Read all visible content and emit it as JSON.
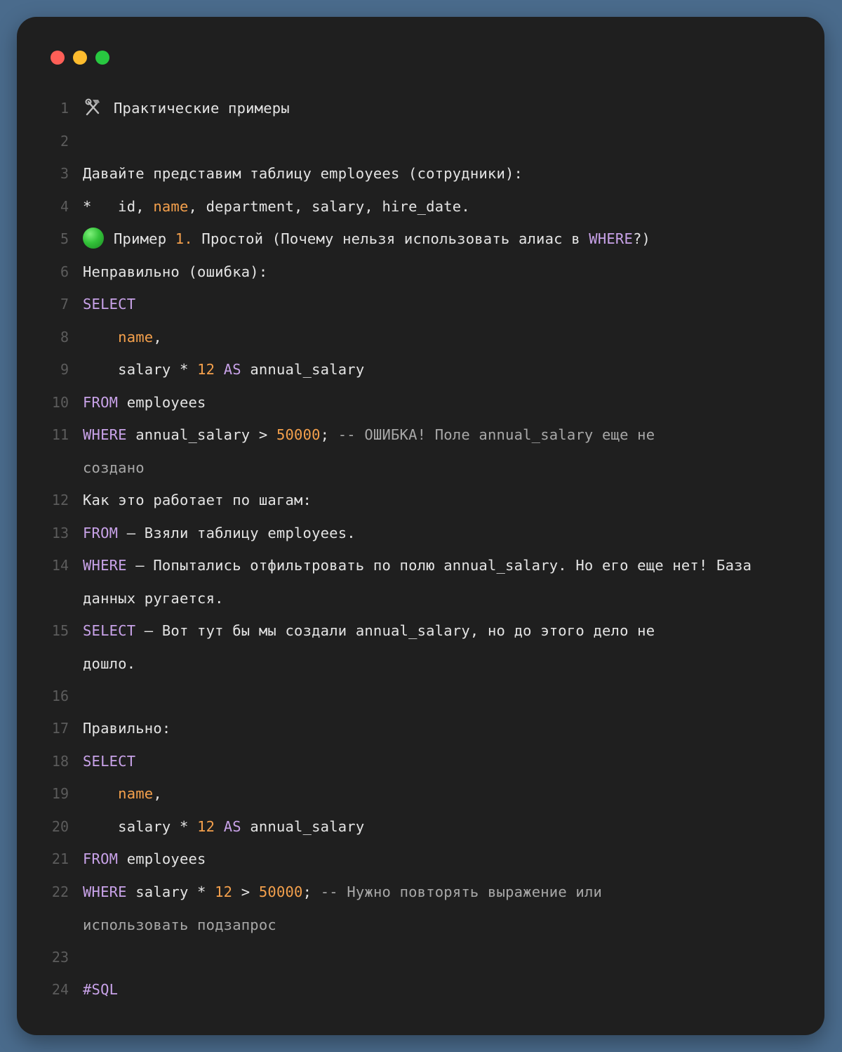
{
  "window": {
    "controls": [
      "close",
      "minimize",
      "maximize"
    ]
  },
  "icons": {
    "line1": "hammer-and-wrench-icon",
    "line5": "green-circle-icon"
  },
  "lines": [
    {
      "n": "1",
      "parts": [
        "Практические примеры"
      ]
    },
    {
      "n": "2",
      "parts": []
    },
    {
      "n": "3",
      "parts": [
        "Давайте представим таблицу employees (сотрудники):"
      ]
    },
    {
      "n": "4",
      "parts": [
        "*   id, ",
        "name",
        ", department, salary, hire_date."
      ]
    },
    {
      "n": "5",
      "parts": [
        "Пример ",
        "1.",
        " Простой (Почему нельзя использовать алиас в ",
        "WHERE",
        "?)"
      ]
    },
    {
      "n": "6",
      "parts": [
        "Неправильно (ошибка):"
      ]
    },
    {
      "n": "7",
      "parts": [
        "SELECT"
      ]
    },
    {
      "n": "8",
      "parts": [
        "    ",
        "name",
        ","
      ]
    },
    {
      "n": "9",
      "parts": [
        "    salary * ",
        "12",
        " ",
        "AS",
        " annual_salary"
      ]
    },
    {
      "n": "10",
      "parts": [
        "FROM",
        " employees"
      ]
    },
    {
      "n": "11",
      "parts": [
        "WHERE",
        " annual_salary > ",
        "50000",
        "; ",
        "-- ОШИБКА! Поле annual_salary еще не создано"
      ]
    },
    {
      "n": "12",
      "parts": [
        "Как это работает по шагам:"
      ]
    },
    {
      "n": "13",
      "parts": [
        "FROM",
        " — Взяли таблицу employees."
      ]
    },
    {
      "n": "14",
      "parts": [
        "WHERE",
        " — Попытались отфильтровать по полю annual_salary. Но его еще нет! База данных ругается."
      ]
    },
    {
      "n": "15",
      "parts": [
        "SELECT",
        " — Вот тут бы мы создали annual_salary, но до этого дело не дошло."
      ]
    },
    {
      "n": "16",
      "parts": []
    },
    {
      "n": "17",
      "parts": [
        "Правильно:"
      ]
    },
    {
      "n": "18",
      "parts": [
        "SELECT"
      ]
    },
    {
      "n": "19",
      "parts": [
        "    ",
        "name",
        ","
      ]
    },
    {
      "n": "20",
      "parts": [
        "    salary * ",
        "12",
        " ",
        "AS",
        " annual_salary"
      ]
    },
    {
      "n": "21",
      "parts": [
        "FROM",
        " employees"
      ]
    },
    {
      "n": "22",
      "parts": [
        "WHERE",
        " salary * ",
        "12",
        " > ",
        "50000",
        "; ",
        "-- Нужно повторять выражение или использовать подзапрос"
      ]
    },
    {
      "n": "23",
      "parts": []
    },
    {
      "n": "24",
      "parts": [
        "#SQL"
      ]
    }
  ]
}
